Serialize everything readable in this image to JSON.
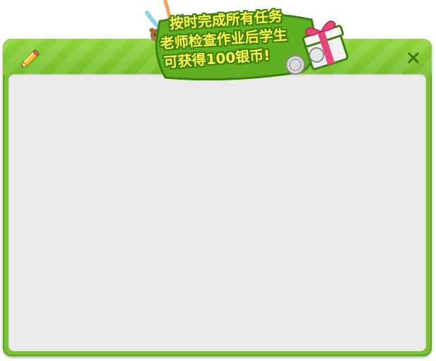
{
  "window": {
    "close_label": "×"
  },
  "banner": {
    "lines": [
      "按时完成所有任务",
      "老师检查作业后学生",
      "可获得100银币!"
    ]
  },
  "colors": {
    "frame_green": "#7bc230",
    "frame_dark": "#5ea51c",
    "content_gray": "#ebebeb",
    "banner_text": "#fff34a",
    "banner_outline": "#3d7f0d",
    "gift_pink": "#e8457a"
  },
  "icons": {
    "edit": "pencil-icon",
    "close": "close-icon",
    "reward": "gift-box-icon",
    "coin": "silver-coin-icon",
    "mascot": "teddy-bear-icon"
  }
}
